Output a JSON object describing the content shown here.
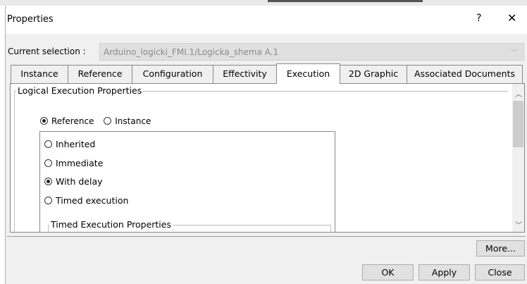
{
  "dialog": {
    "title": "Properties",
    "help_label": "?",
    "close_label": "✕"
  },
  "selection": {
    "label": "Current selection :",
    "value": "Arduino_logicki_FMI.1/Logicka_shema A.1"
  },
  "tabs": [
    {
      "label": "Instance",
      "active": false
    },
    {
      "label": "Reference",
      "active": false
    },
    {
      "label": "Configuration",
      "active": false
    },
    {
      "label": "Effectivity",
      "active": false
    },
    {
      "label": "Execution",
      "active": true
    },
    {
      "label": "2D Graphic",
      "active": false
    },
    {
      "label": "Associated Documents",
      "active": false
    }
  ],
  "execution": {
    "group_title": "Logical Execution Properties",
    "scope_options": [
      {
        "label": "Reference",
        "selected": true
      },
      {
        "label": "Instance",
        "selected": false
      }
    ],
    "modes": [
      {
        "label": "Inherited",
        "selected": false
      },
      {
        "label": "Immediate",
        "selected": false
      },
      {
        "label": "With delay",
        "selected": true
      },
      {
        "label": "Timed execution",
        "selected": false
      }
    ],
    "sub_group_title": "Timed Execution Properties"
  },
  "buttons": {
    "more": "More...",
    "ok": "OK",
    "apply": "Apply",
    "close": "Close"
  }
}
